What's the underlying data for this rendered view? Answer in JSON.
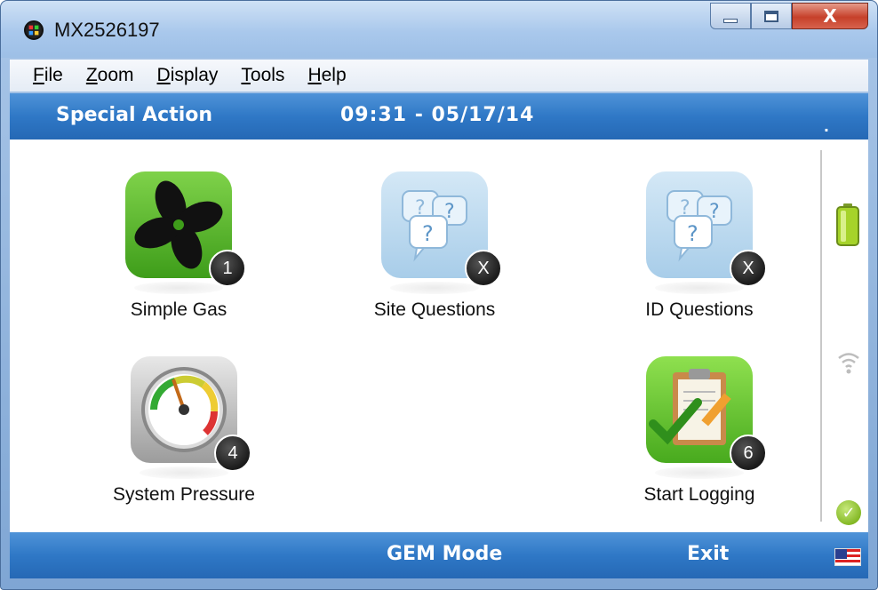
{
  "window": {
    "title": "MX2526197",
    "close_glyph": "X"
  },
  "menu": [
    {
      "first": "F",
      "rest": "ile"
    },
    {
      "first": "Z",
      "rest": "oom"
    },
    {
      "first": "D",
      "rest": "isplay"
    },
    {
      "first": "T",
      "rest": "ools"
    },
    {
      "first": "H",
      "rest": "elp"
    }
  ],
  "header": {
    "title": "Special Action",
    "datetime": "09:31 - 05/17/14",
    "dot": "."
  },
  "tiles": [
    {
      "label": "Simple Gas",
      "badge": "1",
      "icon": "fan-icon"
    },
    {
      "label": "Site Questions",
      "badge": "X",
      "icon": "question-bubbles-icon"
    },
    {
      "label": "ID Questions",
      "badge": "X",
      "icon": "question-bubbles-icon"
    },
    {
      "label": "System Pressure",
      "badge": "4",
      "icon": "pressure-gauge-icon"
    },
    {
      "label": "Start Logging",
      "badge": "6",
      "icon": "clipboard-check-icon"
    }
  ],
  "status": {
    "battery_icon": "battery-icon",
    "wifi_icon": "wifi-icon",
    "ok_icon": "checkmark-icon",
    "ok_glyph": "✓"
  },
  "footer": {
    "gem_mode": "GEM Mode",
    "exit": "Exit",
    "flag_icon": "us-flag-icon"
  },
  "colors": {
    "header_blue": "#2f78c6",
    "accent_green": "#48aa1e"
  }
}
